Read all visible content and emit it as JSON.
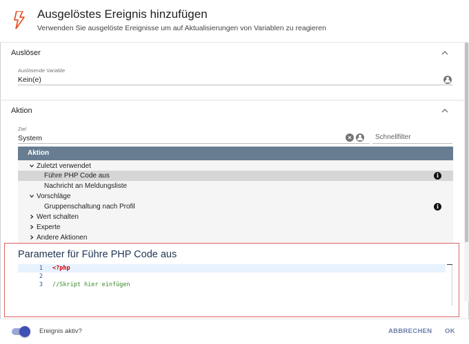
{
  "colors": {
    "accent_orange": "#e8552b",
    "tree_header": "#687d91",
    "toggle_on": "#3f51b5",
    "param_border": "#e06060",
    "button_text": "#6b7fa8"
  },
  "header": {
    "icon": "lightning-bolt-icon",
    "title": "Ausgelöstes Ereignis hinzufügen",
    "subtitle": "Verwenden Sie ausgelöste Ereignisse um auf Aktualisierungen von Variablen zu reagieren"
  },
  "trigger_section": {
    "label": "Auslöser",
    "field_label": "Auslösende Variable",
    "field_value": "Kein(e)"
  },
  "action_section": {
    "label": "Aktion",
    "target_label": "Ziel",
    "target_value": "System",
    "filter_placeholder": "Schnellfilter",
    "tree": {
      "header": "Aktion",
      "items": [
        {
          "label": "Zuletzt verwendet",
          "kind": "group",
          "expanded": true
        },
        {
          "label": "Führe PHP Code aus",
          "kind": "item",
          "selected": true,
          "info": true
        },
        {
          "label": "Nachricht an Meldungsliste",
          "kind": "item"
        },
        {
          "label": "Vorschläge",
          "kind": "group",
          "expanded": true
        },
        {
          "label": "Gruppenschaltung nach Profil",
          "kind": "item",
          "info": true
        },
        {
          "label": "Wert schalten",
          "kind": "group",
          "expanded": false
        },
        {
          "label": "Experte",
          "kind": "group",
          "expanded": false
        },
        {
          "label": "Andere Aktionen",
          "kind": "group",
          "expanded": false
        }
      ]
    }
  },
  "parameters": {
    "title": "Parameter für Führe PHP Code aus",
    "code_lines": [
      {
        "num": "1",
        "text": "<?php"
      },
      {
        "num": "2",
        "text": ""
      },
      {
        "num": "3",
        "text": "//Skript hier einfügen"
      }
    ]
  },
  "footer": {
    "toggle_label": "Ereignis aktiv?",
    "toggle_on": true,
    "cancel_label": "ABBRECHEN",
    "ok_label": "OK"
  }
}
